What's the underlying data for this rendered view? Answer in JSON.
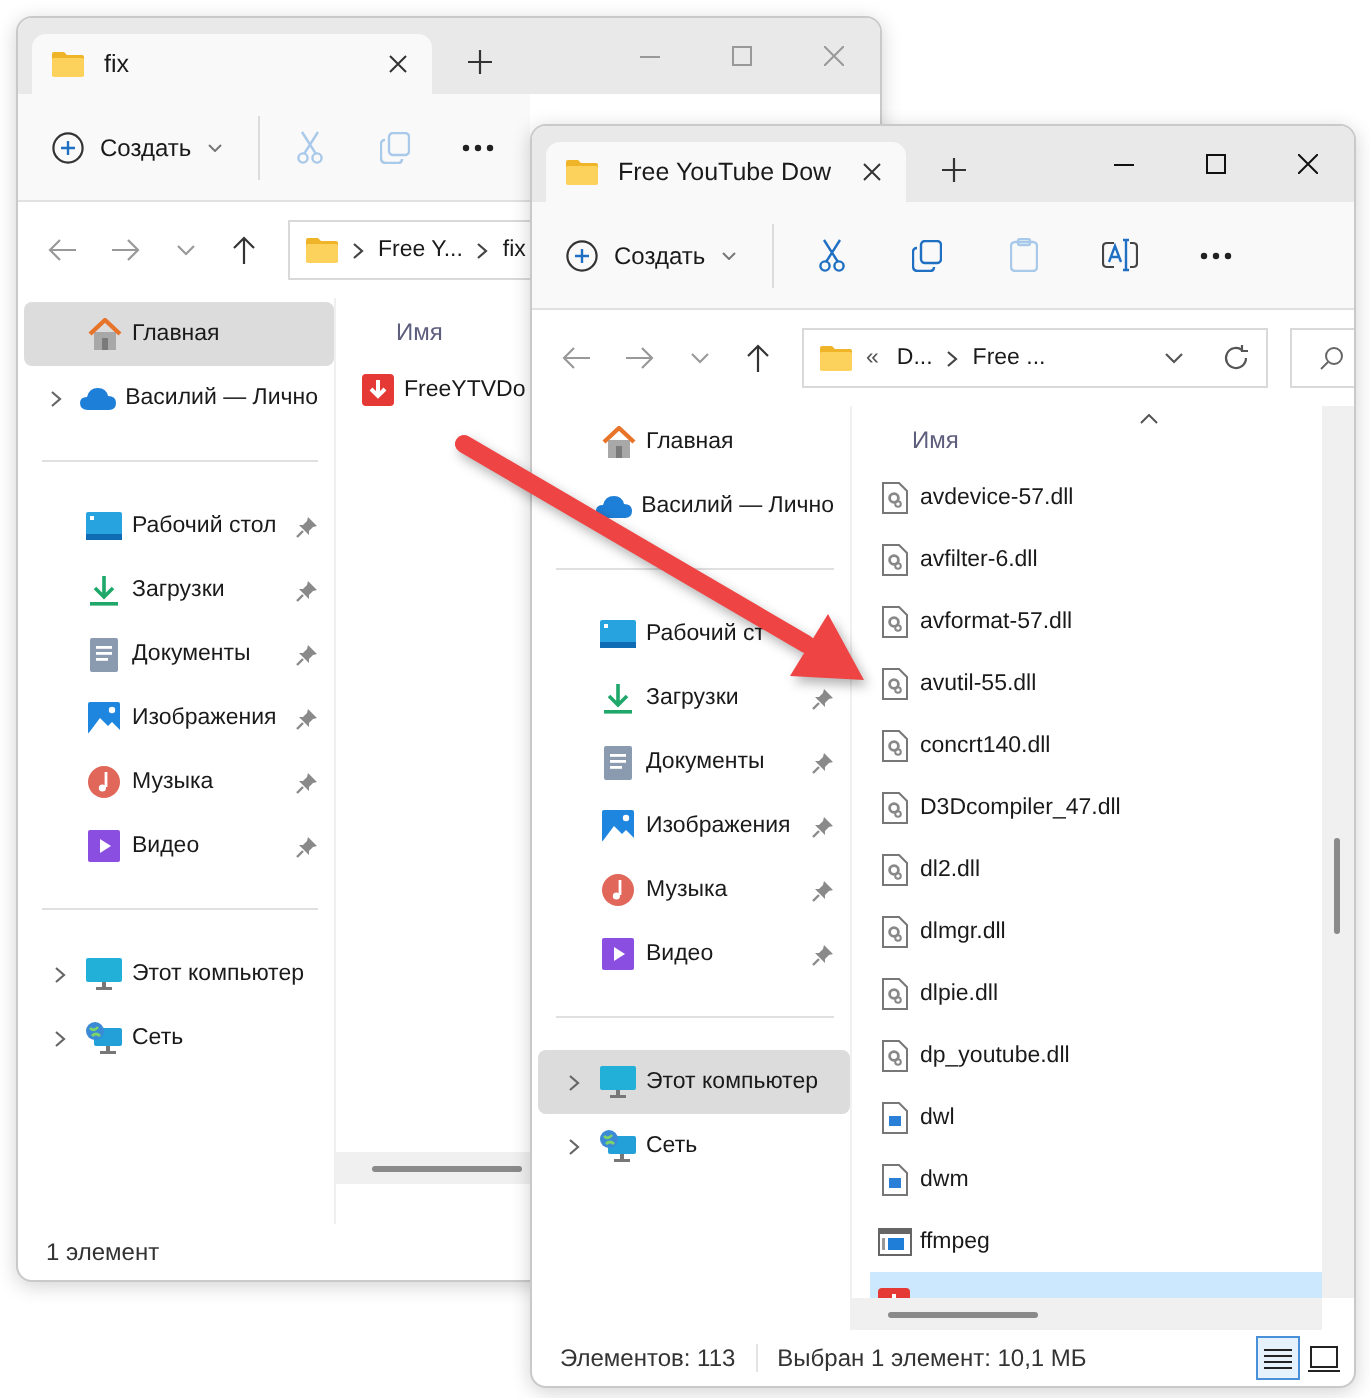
{
  "windows": [
    {
      "active": false,
      "tab": {
        "title": "fix"
      },
      "new_button": "Создать",
      "tools": [
        {
          "kind": "cut",
          "disabled": true
        },
        {
          "kind": "copy",
          "disabled": true
        },
        {
          "kind": "more",
          "disabled": false
        }
      ],
      "address": {
        "segments": [
          "Free Y...",
          "fix"
        ]
      },
      "sidebar": [
        {
          "items": [
            {
              "label": "Главная",
              "kind": "home",
              "expandable": false,
              "pinned": false,
              "selected": true
            },
            {
              "label": "Василий — Лично",
              "kind": "cloud",
              "expandable": true,
              "pinned": false,
              "selected": false
            }
          ]
        },
        {
          "items": [
            {
              "label": "Рабочий стол",
              "kind": "desktop",
              "expandable": false,
              "pinned": true,
              "selected": false
            },
            {
              "label": "Загрузки",
              "kind": "downloads",
              "expandable": false,
              "pinned": true,
              "selected": false
            },
            {
              "label": "Документы",
              "kind": "documents",
              "expandable": false,
              "pinned": true,
              "selected": false
            },
            {
              "label": "Изображения",
              "kind": "pictures",
              "expandable": false,
              "pinned": true,
              "selected": false
            },
            {
              "label": "Музыка",
              "kind": "music",
              "expandable": false,
              "pinned": true,
              "selected": false
            },
            {
              "label": "Видео",
              "kind": "videos",
              "expandable": false,
              "pinned": true,
              "selected": false
            }
          ]
        },
        {
          "items": [
            {
              "label": "Этот компьютер",
              "kind": "pc",
              "expandable": true,
              "pinned": false,
              "selected": false
            },
            {
              "label": "Сеть",
              "kind": "network",
              "expandable": true,
              "pinned": false,
              "selected": false
            }
          ]
        }
      ],
      "column_header": "Имя",
      "files": [
        {
          "name": "FreeYTVDo",
          "kind": "app",
          "selected": false
        }
      ],
      "status": [
        "1 элемент"
      ]
    },
    {
      "active": true,
      "tab": {
        "title": "Free YouTube Dow"
      },
      "new_button": "Создать",
      "tools": [
        {
          "kind": "cut",
          "disabled": false
        },
        {
          "kind": "copy",
          "disabled": false
        },
        {
          "kind": "paste",
          "disabled": true
        },
        {
          "kind": "rename",
          "disabled": false
        },
        {
          "kind": "more",
          "disabled": false
        }
      ],
      "address": {
        "overflow": "«",
        "segments": [
          "D...",
          "Free ..."
        ],
        "refresh": true
      },
      "search": true,
      "sidebar": [
        {
          "items": [
            {
              "label": "Главная",
              "kind": "home",
              "expandable": false,
              "pinned": false,
              "selected": false
            },
            {
              "label": "Василий — Лично",
              "kind": "cloud",
              "pinned": false,
              "selected": false
            }
          ]
        },
        {
          "items": [
            {
              "label": "Рабочий ст",
              "kind": "desktop",
              "expandable": false,
              "selected": false
            },
            {
              "label": "Загрузки",
              "kind": "downloads",
              "expandable": false,
              "pinned": true,
              "selected": false
            },
            {
              "label": "Документы",
              "kind": "documents",
              "expandable": false,
              "pinned": true,
              "selected": false
            },
            {
              "label": "Изображения",
              "kind": "pictures",
              "expandable": false,
              "pinned": true,
              "selected": false
            },
            {
              "label": "Музыка",
              "kind": "music",
              "expandable": false,
              "pinned": true,
              "selected": false
            },
            {
              "label": "Видео",
              "kind": "videos",
              "expandable": false,
              "pinned": true,
              "selected": false
            }
          ]
        },
        {
          "items": [
            {
              "label": "Этот компьютер",
              "kind": "pc",
              "expandable": true,
              "pinned": false,
              "selected": true
            },
            {
              "label": "Сеть",
              "kind": "network",
              "expandable": true,
              "pinned": false,
              "selected": false
            }
          ]
        }
      ],
      "column_header": "Имя",
      "sort_indicator": true,
      "files": [
        {
          "name": "avdevice-57.dll",
          "kind": "dll",
          "selected": false
        },
        {
          "name": "avfilter-6.dll",
          "kind": "dll",
          "selected": false
        },
        {
          "name": "avformat-57.dll",
          "kind": "dll",
          "selected": false
        },
        {
          "name": "avutil-55.dll",
          "kind": "dll",
          "selected": false
        },
        {
          "name": "concrt140.dll",
          "kind": "dll",
          "selected": false
        },
        {
          "name": "D3Dcompiler_47.dll",
          "kind": "dll",
          "selected": false
        },
        {
          "name": "dl2.dll",
          "kind": "dll",
          "selected": false
        },
        {
          "name": "dlmgr.dll",
          "kind": "dll",
          "selected": false
        },
        {
          "name": "dlpie.dll",
          "kind": "dll",
          "selected": false
        },
        {
          "name": "dp_youtube.dll",
          "kind": "dll",
          "selected": false
        },
        {
          "name": "dwl",
          "kind": "image",
          "selected": false
        },
        {
          "name": "dwm",
          "kind": "image",
          "selected": false
        },
        {
          "name": "ffmpeg",
          "kind": "program",
          "selected": false
        },
        {
          "kind": "app",
          "selected": true
        }
      ],
      "status": [
        "Элементов: 113",
        "Выбран 1 элемент: 10,1 МБ"
      ],
      "view_buttons": [
        {
          "kind": "details",
          "selected": true
        },
        {
          "kind": "tiles",
          "selected": false
        }
      ]
    }
  ]
}
